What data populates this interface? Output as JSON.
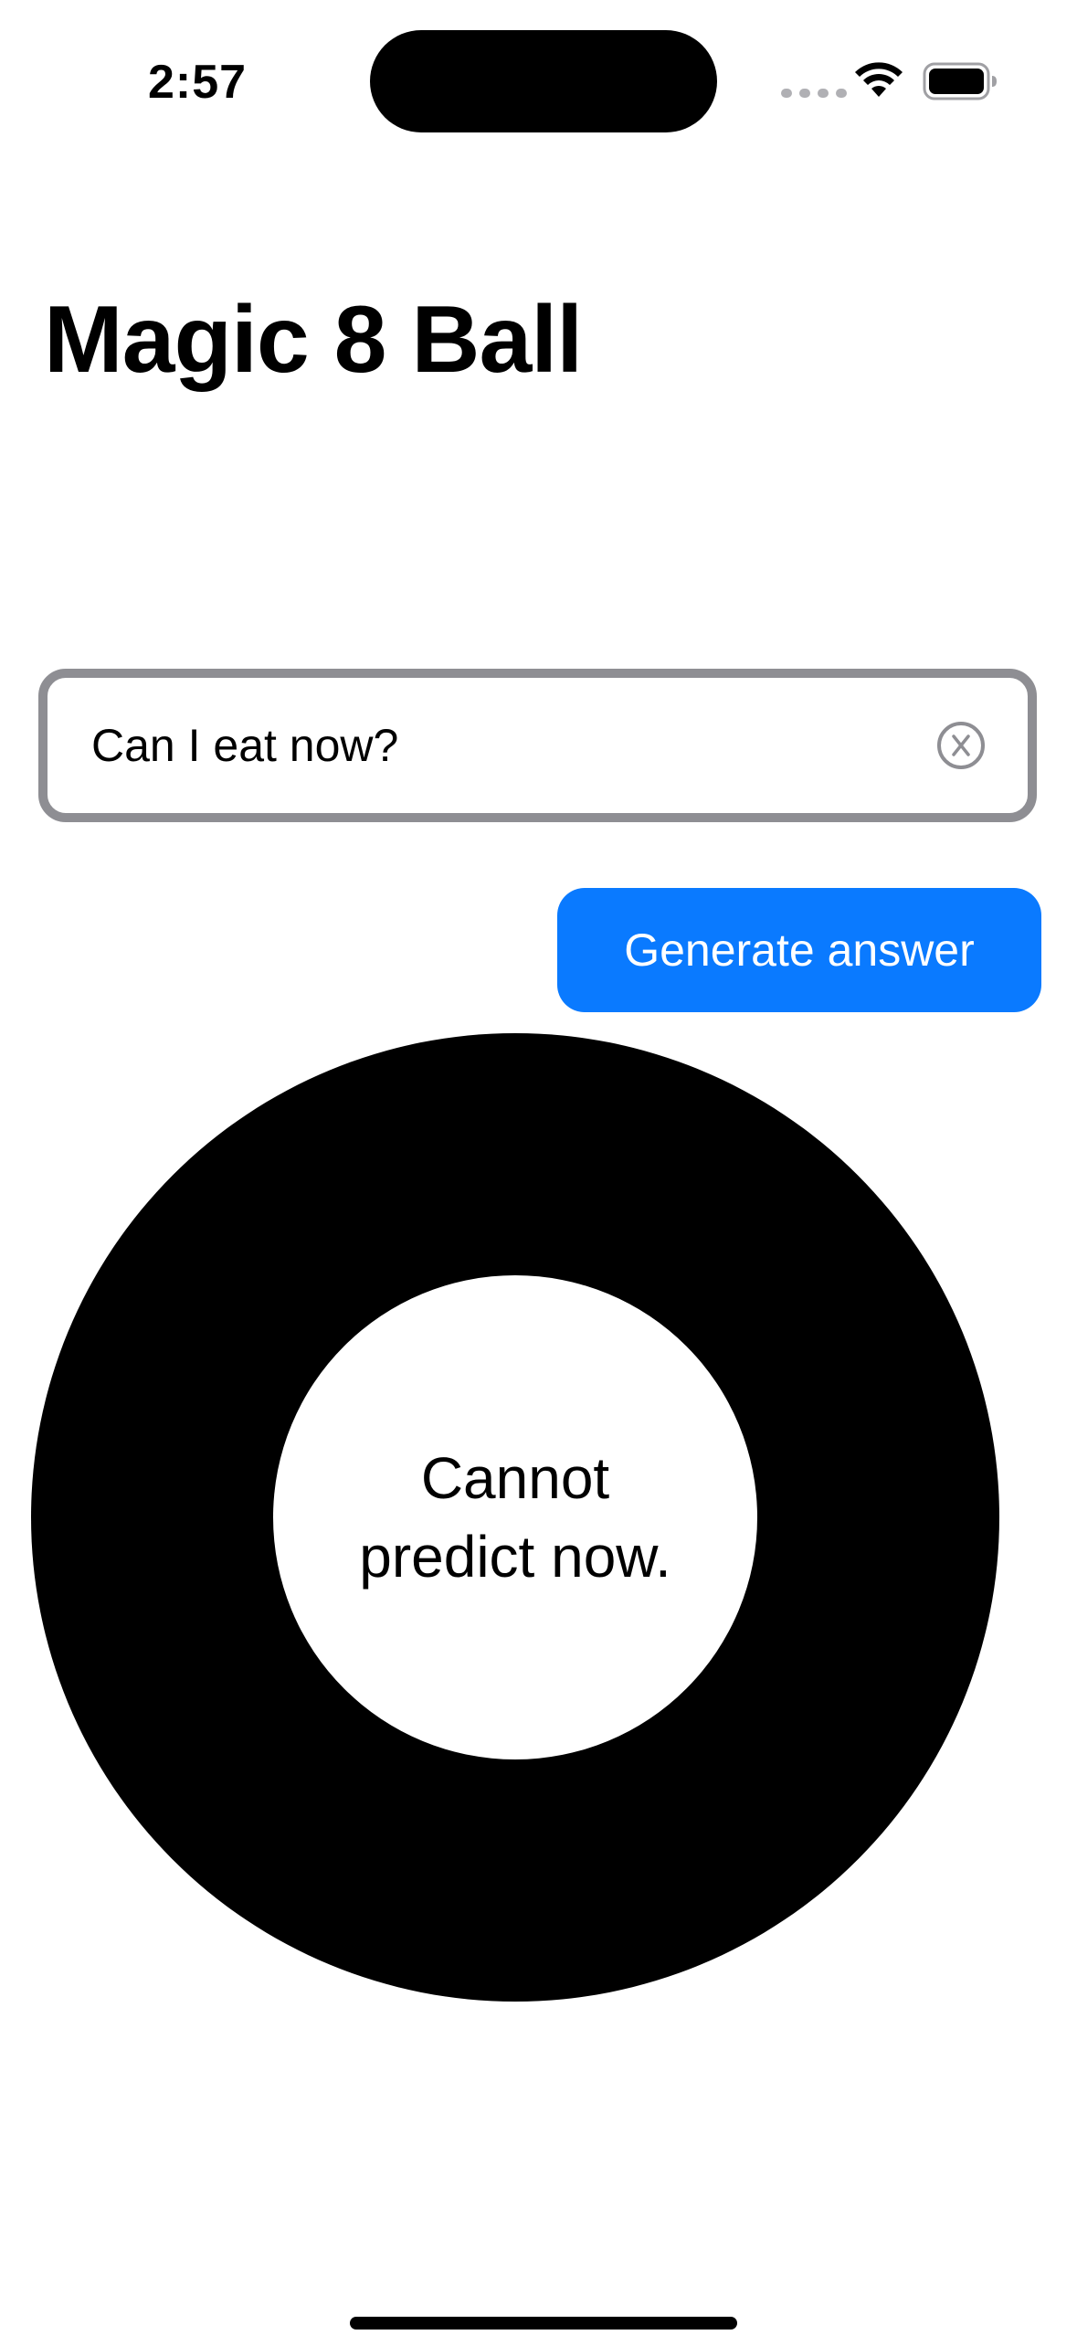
{
  "status_bar": {
    "time": "2:57",
    "icons": [
      "cellular-signal-icon",
      "wifi-icon",
      "battery-icon"
    ]
  },
  "app": {
    "title": "Magic 8 Ball"
  },
  "question_field": {
    "value": "Can I eat now?",
    "clear_icon": "clear-circle-icon"
  },
  "generate_button": {
    "label": "Generate answer"
  },
  "eight_ball": {
    "answer": "Cannot predict now."
  },
  "colors": {
    "accent": "#0a7aff",
    "field_border": "#8e8e93",
    "ball": "#000000",
    "background": "#ffffff"
  }
}
